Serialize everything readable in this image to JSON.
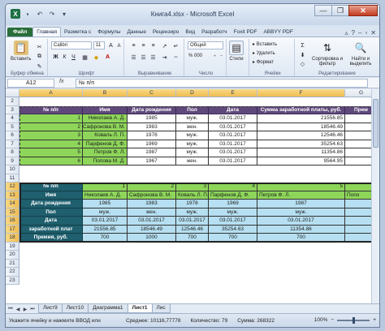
{
  "window": {
    "title": "Книга4.xlsx - Microsoft Excel",
    "qat_undo": "↶",
    "qat_redo": "↷",
    "close": "✕",
    "restore": "❐",
    "minimize": "—"
  },
  "tabs": [
    "Файл",
    "Главная",
    "Разметка с",
    "Формулы",
    "Данные",
    "Рецензиро",
    "Вид",
    "Разработч",
    "Foxit PDF",
    "ABBYY PDF"
  ],
  "ribbon": {
    "paste": "Вставить",
    "clipboard": "Буфер обмена",
    "font_name": "Calibri",
    "font_size": "11",
    "font": "Шрифт",
    "alignment": "Выравнивание",
    "number_format": "Общий",
    "percent": "% 000",
    "number": "Число",
    "styles": "Стили",
    "insert": "Вставить",
    "delete": "Удалить",
    "format": "Формат",
    "cells": "Ячейки",
    "sort": "Сортировка и фильтр",
    "find": "Найти и выделить",
    "editing": "Редактирование"
  },
  "formula_bar": {
    "name_box": "A12",
    "fx": "fx",
    "value": "№ п/п"
  },
  "columns": [
    "A",
    "B",
    "C",
    "D",
    "E",
    "F",
    "G"
  ],
  "rows": [
    "2",
    "3",
    "4",
    "5",
    "6",
    "7",
    "8",
    "9",
    "10",
    "11",
    "12",
    "13",
    "14",
    "15",
    "16",
    "17",
    "18",
    "19",
    "20",
    "21",
    "22",
    "23"
  ],
  "table1": {
    "headers": [
      "№ п/п",
      "Имя",
      "Дата рождения",
      "Пол",
      "Дата",
      "Сумма заработной платы, руб.",
      "Прем"
    ],
    "rows": [
      [
        "1",
        "Николаев А. Д.",
        "1985",
        "муж.",
        "03.01.2017",
        "21556.85"
      ],
      [
        "2",
        "Сафронова В. М.",
        "1983",
        "жен.",
        "03.01.2017",
        "18546.49"
      ],
      [
        "3",
        "Коваль Л. П.",
        "1978",
        "муж.",
        "03.01.2017",
        "12546.46"
      ],
      [
        "4",
        "Парфенов Д. Ф.",
        "1969",
        "муж.",
        "03.01.2017",
        "35254.63"
      ],
      [
        "5",
        "Петров Ф. Л.",
        "1987",
        "муж.",
        "03.01.2017",
        "11354.86"
      ],
      [
        "6",
        "Попова М. Д.",
        "1967",
        "жен.",
        "03.01.2017",
        "9564.95"
      ]
    ]
  },
  "table2": {
    "row_labels": [
      "№ п/п",
      "Имя",
      "Дата рождения",
      "Пол",
      "Дата",
      "заработной плат",
      "Премия, руб."
    ],
    "numbers": [
      "1",
      "2",
      "3",
      "4",
      "5"
    ],
    "names": [
      "Николаев А. Д.",
      "Сафронова В. М.",
      "Коваль Л. П.",
      "Парфенов Д. Ф.",
      "Петров Ф. Л.",
      "Попо"
    ],
    "years": [
      "1985",
      "1983",
      "1978",
      "1969",
      "1987"
    ],
    "genders": [
      "муж.",
      "жен.",
      "муж.",
      "муж.",
      "муж."
    ],
    "dates": [
      "03.01.2017",
      "03.01.2017",
      "03.01.2017",
      "03.01.2017",
      "03.01.2017"
    ],
    "salaries": [
      "21556.85",
      "18546.49",
      "12546.46",
      "35254.63",
      "11354.86"
    ],
    "bonuses": [
      "700",
      "1000",
      "700",
      "700",
      "700"
    ]
  },
  "sheets": [
    "Лист9",
    "Лист10",
    "Диаграмма1",
    "Лист1",
    "Лис"
  ],
  "status": {
    "message": "Укажите ячейку и нажмите ВВОД или",
    "average": "Среднее: 10116,77778",
    "count": "Количество: 79",
    "sum": "Сумма: 268322",
    "zoom": "100%"
  }
}
